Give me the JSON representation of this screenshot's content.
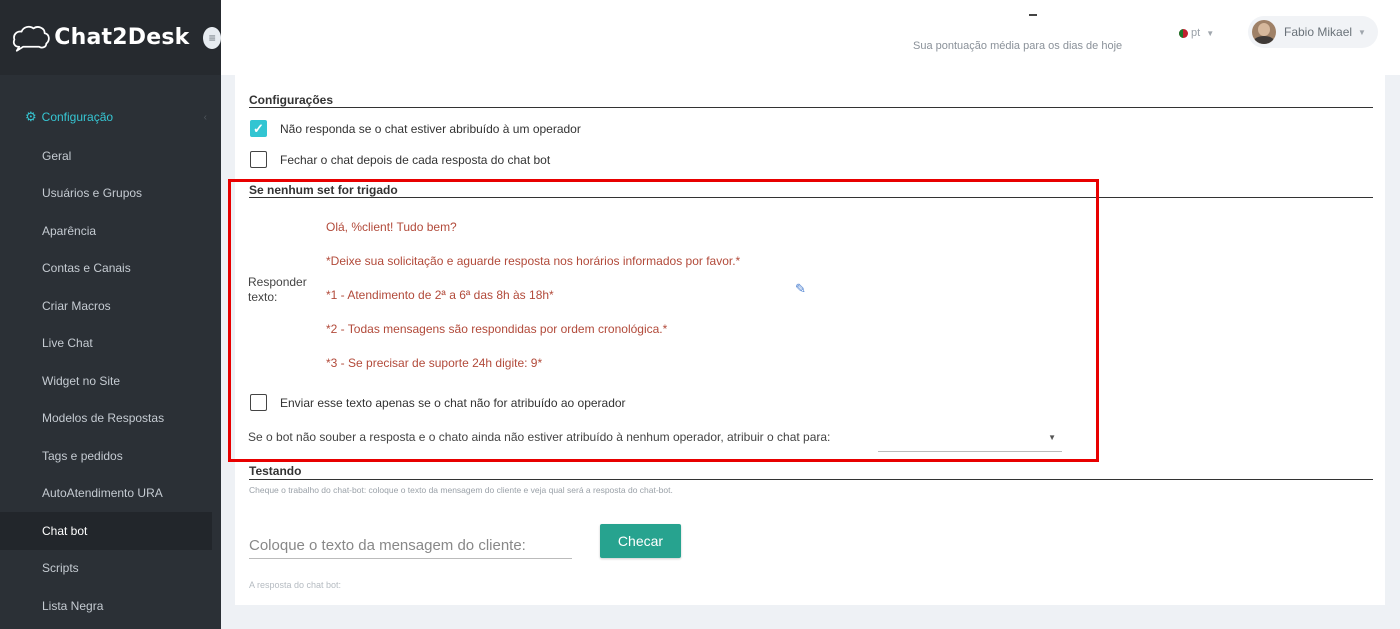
{
  "brand": {
    "name": "Chat2Desk"
  },
  "sidebar": {
    "section": "Configuração",
    "items": [
      {
        "label": "Geral"
      },
      {
        "label": "Usuários e Grupos"
      },
      {
        "label": "Aparência"
      },
      {
        "label": "Contas e Canais"
      },
      {
        "label": "Criar Macros"
      },
      {
        "label": "Live Chat"
      },
      {
        "label": "Widget no Site"
      },
      {
        "label": "Modelos de Respostas"
      },
      {
        "label": "Tags e pedidos"
      },
      {
        "label": "AutoAtendimento URA"
      },
      {
        "label": "Chat bot",
        "active": true
      },
      {
        "label": "Scripts"
      },
      {
        "label": "Lista Negra"
      }
    ]
  },
  "header": {
    "score_value": "–",
    "score_label": "Sua pontuação média para os dias de hoje",
    "language": "pt",
    "user_name": "Fabio Mikael"
  },
  "settings": {
    "title": "Configurações",
    "options": [
      {
        "label": "Não responda se o chat estiver abribuído à um operador",
        "checked": true
      },
      {
        "label": "Fechar o chat depois de cada resposta do chat bot",
        "checked": false
      }
    ]
  },
  "fallback": {
    "title": "Se nenhum set for trigado",
    "reply_label_line1": "Responder",
    "reply_label_line2": "texto:",
    "reply_lines": [
      "Olá, %client! Tudo bem?",
      "*Deixe sua solicitação e aguarde resposta nos horários informados por favor.*",
      "*1 - Atendimento de 2ª a 6ª das 8h às 18h*",
      "*2 - Todas mensagens são respondidas por ordem cronológica.*",
      "*3 - Se precisar de suporte 24h digite: 9*"
    ],
    "only_unassigned_label": "Enviar esse texto apenas se o chat não for atribuído ao operador",
    "only_unassigned_checked": false,
    "assign_label": "Se o bot não souber a resposta e o chato ainda não estiver atribuído à nenhum operador, atribuir o chat para:",
    "assign_value": ""
  },
  "testing": {
    "title": "Testando",
    "hint": "Cheque o trabalho do chat-bot: coloque o texto da mensagem do cliente e veja qual será a resposta do chat-bot.",
    "input_placeholder": "Coloque o texto da mensagem do cliente:",
    "check_button": "Checar",
    "bot_answer_label": "A resposta do chat bot:"
  },
  "colors": {
    "accent": "#32c5d2",
    "button": "#27a38f",
    "highlight_box": "#e80000",
    "reply_text": "#b24a3a"
  }
}
